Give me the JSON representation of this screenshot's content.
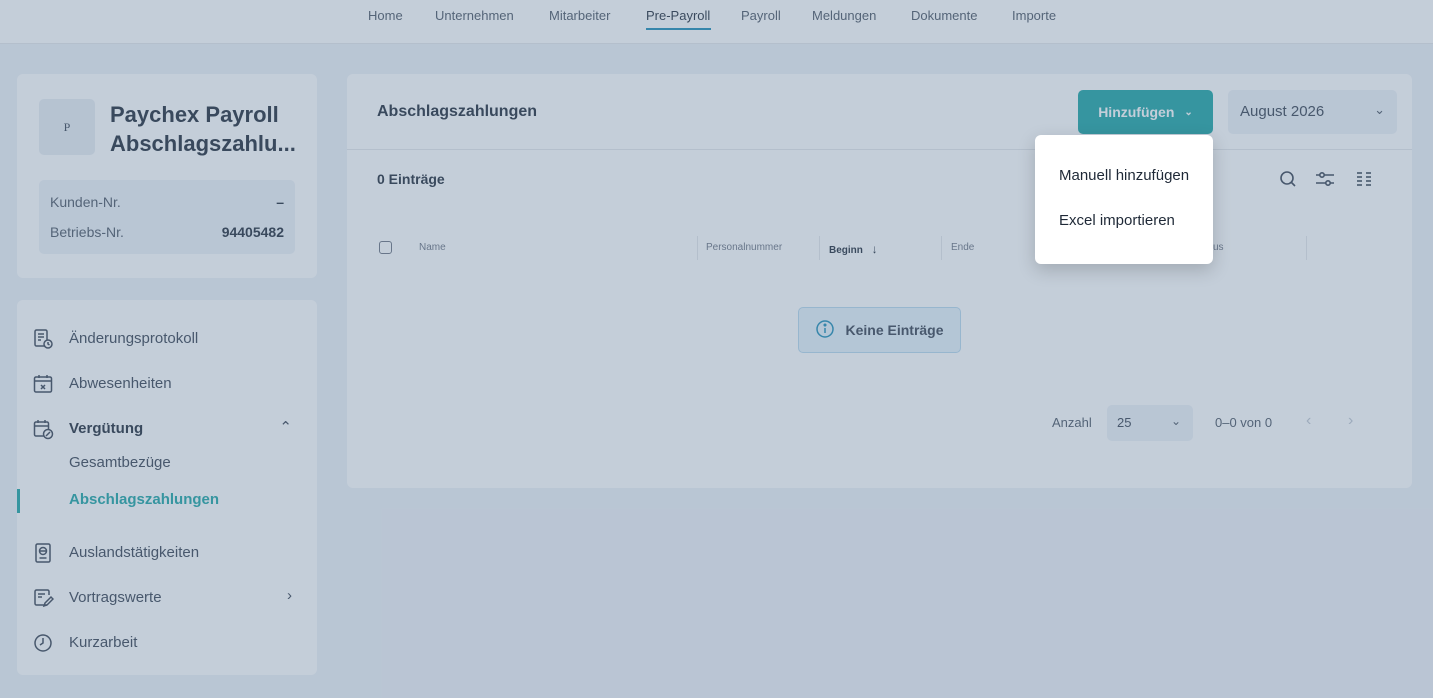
{
  "nav": {
    "items": [
      {
        "label": "Home",
        "active": false
      },
      {
        "label": "Unternehmen",
        "active": false
      },
      {
        "label": "Mitarbeiter",
        "active": false
      },
      {
        "label": "Pre-Payroll",
        "active": true
      },
      {
        "label": "Payroll",
        "active": false
      },
      {
        "label": "Meldungen",
        "active": false
      },
      {
        "label": "Dokumente",
        "active": false
      },
      {
        "label": "Importe",
        "active": false
      }
    ]
  },
  "company": {
    "avatar_letter": "P",
    "name_line1": "Paychex Payroll",
    "name_line2": "Abschlagszahlu...",
    "customer_label": "Kunden-Nr.",
    "customer_value": "–",
    "operation_label": "Betriebs-Nr.",
    "operation_value": "94405482"
  },
  "sidemenu": {
    "changelog": "Änderungsprotokoll",
    "absences": "Abwesenheiten",
    "compensation": "Vergütung",
    "compensation_sub": {
      "total": "Gesamtbezüge",
      "advances": "Abschlagszahlungen"
    },
    "foreign": "Auslandstätigkeiten",
    "carryover": "Vortragswerte",
    "short_time": "Kurzarbeit"
  },
  "main": {
    "title": "Abschlagszahlungen",
    "add_button": "Hinzufügen",
    "month": "August 2026",
    "count": "0 Einträge",
    "columns": {
      "name": "Name",
      "personnel_no": "Personalnummer",
      "start": "Beginn",
      "end": "Ende",
      "status_partial": "us"
    },
    "empty_message": "Keine Einträge",
    "pager": {
      "label": "Anzahl",
      "page_size": "25",
      "range": "0–0 von 0"
    }
  },
  "dropdown": {
    "manual": "Manuell hinzufügen",
    "excel": "Excel importieren"
  },
  "colors": {
    "accent": "#1aa3a3",
    "nav_underline": "#1a8bb5",
    "overlay": "rgba(100,125,155,0.38)"
  }
}
